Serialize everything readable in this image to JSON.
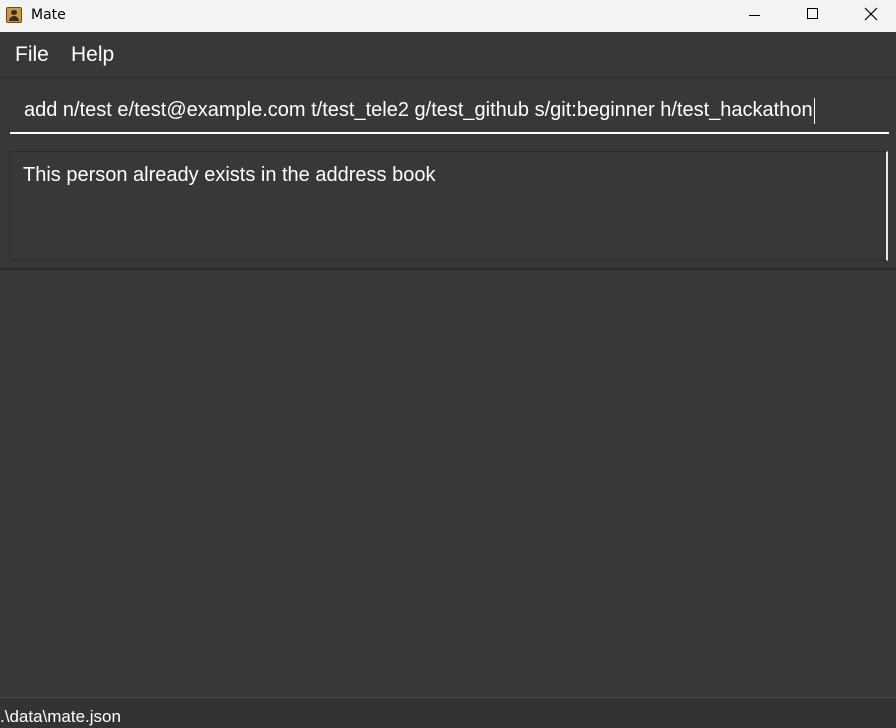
{
  "window": {
    "title": "Mate",
    "icon": "address-book-icon"
  },
  "menu": {
    "file_label": "File",
    "help_label": "Help"
  },
  "command": {
    "value": "add n/test e/test@example.com t/test_tele2 g/test_github s/git:beginner h/test_hackathon"
  },
  "result": {
    "message": "This person already exists in the address book"
  },
  "status": {
    "file_path": ".\\data\\mate.json"
  },
  "colors": {
    "background": "#383838",
    "titlebar": "#f3f3f3",
    "text": "#ffffff"
  }
}
